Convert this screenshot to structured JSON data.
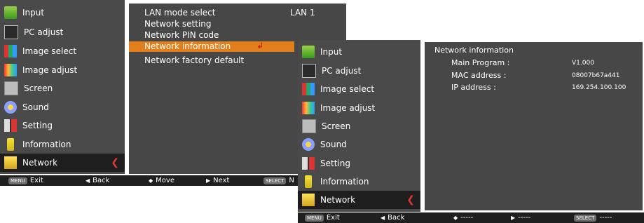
{
  "sidebar_items": [
    "Input",
    "PC adjust",
    "Image select",
    "Image adjust",
    "Screen",
    "Sound",
    "Setting",
    "Information",
    "Network"
  ],
  "left": {
    "lan_mode_label": "LAN mode select",
    "lan_mode_value": "LAN 1",
    "items": [
      "Network setting",
      "Network PIN code",
      "Network information",
      "Network factory default"
    ],
    "enter_glyph": "↲"
  },
  "right": {
    "title": "Network information",
    "rows": [
      {
        "label": "Main Program :",
        "value": "V1.000"
      },
      {
        "label": "MAC address :",
        "value": "08007b67a441"
      },
      {
        "label": "IP address :",
        "value": "169.254.100.100"
      }
    ]
  },
  "left_bar": {
    "menu_key": "MENU",
    "exit": "Exit",
    "back": "Back",
    "move": "Move",
    "next": "Next",
    "select_key": "SELECT",
    "trailing": "N"
  },
  "right_bar": {
    "menu_key": "MENU",
    "exit": "Exit",
    "back": "Back",
    "move": "-----",
    "next": "-----",
    "select_key": "SELECT",
    "select_label": "-----"
  },
  "icons": [
    "input-icon",
    "pc-adjust-icon",
    "image-select-icon",
    "image-adjust-icon",
    "screen-icon",
    "sound-icon",
    "setting-icon",
    "information-icon",
    "network-icon"
  ],
  "colors": {
    "highlight": "#e37f1a",
    "panel": "#474747",
    "active": "#1e1e1e",
    "arrow": "#e23636"
  }
}
